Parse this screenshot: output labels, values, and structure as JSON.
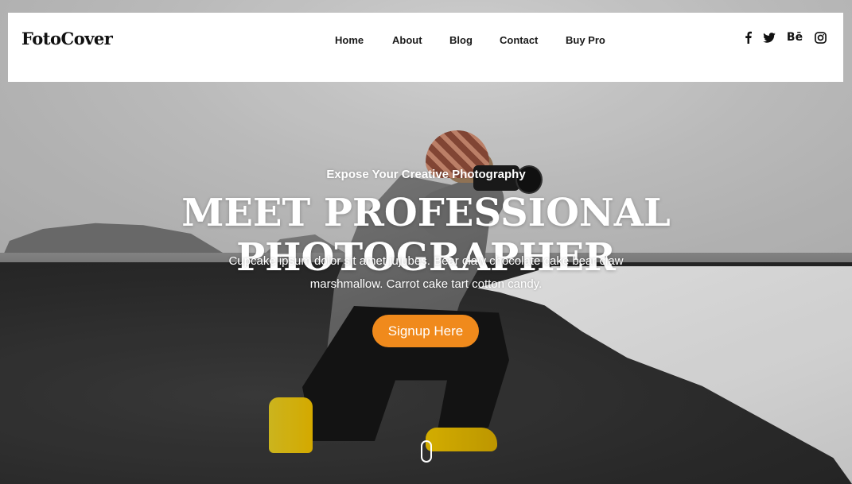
{
  "header": {
    "logo": "FotoCover",
    "nav": [
      {
        "label": "Home"
      },
      {
        "label": "About"
      },
      {
        "label": "Blog"
      },
      {
        "label": "Contact"
      },
      {
        "label": "Buy Pro"
      }
    ],
    "social": [
      {
        "name": "facebook-icon",
        "glyph": "f"
      },
      {
        "name": "twitter-icon",
        "glyph": "🐦"
      },
      {
        "name": "behance-icon",
        "glyph": "Bē"
      },
      {
        "name": "instagram-icon",
        "glyph": "◎"
      }
    ]
  },
  "hero": {
    "tagline": "Expose Your Creative Photography",
    "headline": "MEET PROFESSIONAL PHOTOGRAPHER",
    "description": "Cupcake ipsum dolor sit amet jujubes. Bear claw chocolate cake bear claw marshmallow. Carrot cake tart cotton candy.",
    "cta_label": "Signup Here",
    "cta_color": "#f08a1c"
  }
}
